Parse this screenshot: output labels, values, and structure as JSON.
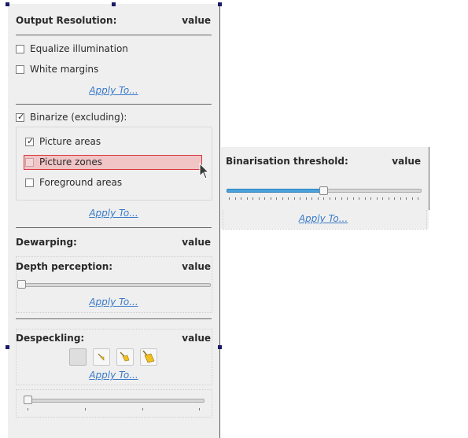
{
  "output": {
    "title": "Output Resolution:",
    "value": "value"
  },
  "options": {
    "equalize": "Equalize illumination",
    "white_margins": "White margins",
    "apply_to": "Apply To..."
  },
  "binarize": {
    "label": "Binarize (excluding):",
    "checked": true,
    "picture_areas": "Picture areas",
    "picture_zones": "Picture zones",
    "foreground_areas": "Foreground areas",
    "apply_to": "Apply To..."
  },
  "dewarping": {
    "title": "Dewarping:",
    "value": "value",
    "depth_title": "Depth perception:",
    "depth_value": "value",
    "depth_level": 0,
    "apply_to": "Apply To..."
  },
  "despeckling": {
    "title": "Despeckling:",
    "value": "value",
    "buttons": [
      "despeckle-off-icon",
      "broom-small-icon",
      "broom-medium-icon",
      "broom-large-icon"
    ],
    "apply_to": "Apply To...",
    "level": 0
  },
  "threshold": {
    "title": "Binarisation threshold:",
    "value": "value",
    "level_fraction": 0.5,
    "apply_to": "Apply To..."
  },
  "colors": {
    "accent": "#4aa3dd",
    "highlight_bg": "#f1c4c6",
    "highlight_border": "#d9363e",
    "link": "#3a7ac8"
  }
}
